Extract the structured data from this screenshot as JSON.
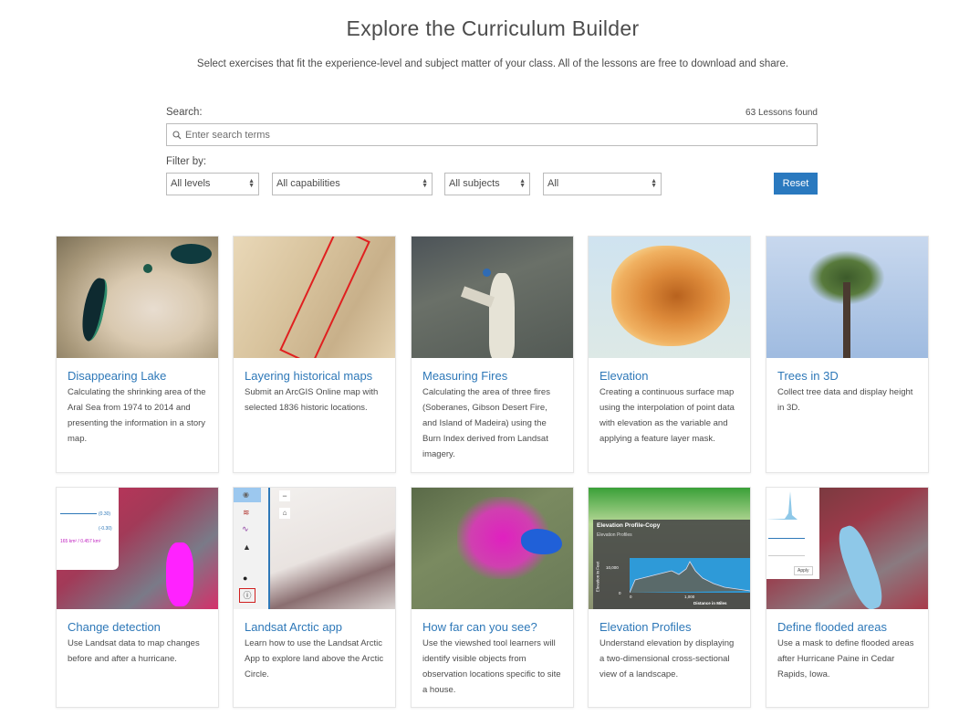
{
  "header": {
    "title": "Explore the Curriculum Builder",
    "subtitle": "Select exercises that fit the experience-level and subject matter of your class. All of the lessons are free to download and share."
  },
  "search": {
    "label": "Search:",
    "placeholder": "Enter search terms",
    "value": "",
    "results_count": "63 Lessons found",
    "icon": "search-icon"
  },
  "filters": {
    "label": "Filter by:",
    "levels": "All levels",
    "capabilities": "All capabilities",
    "subjects": "All subjects",
    "other": "All",
    "reset_label": "Reset"
  },
  "colors": {
    "accent": "#2a79bf",
    "card_title": "#2e78b8",
    "text": "#4c4c4c"
  },
  "lessons": [
    {
      "title": "Disappearing Lake",
      "description": "Calculating the shrinking area of the Aral Sea from 1974 to 2014 and presenting the information in a story map.",
      "thumbnail": "aral-sea-satellite-image"
    },
    {
      "title": "Layering historical maps",
      "description": "Submit an ArcGIS Online map with selected 1836 historic locations.",
      "thumbnail": "historic-map-image"
    },
    {
      "title": "Measuring Fires",
      "description": "Calculating the area of three fires (Soberanes, Gibson Desert Fire, and Island of Madeira) using the Burn Index derived from Landsat imagery.",
      "thumbnail": "burn-scar-image"
    },
    {
      "title": "Elevation",
      "description": "Creating a continuous surface map using the interpolation of point data with elevation as the variable and applying a feature layer mask.",
      "thumbnail": "elevation-surface-map"
    },
    {
      "title": "Trees in 3D",
      "description": "Collect tree data and display height in 3D.",
      "thumbnail": "palm-tree-photo"
    },
    {
      "title": "Change detection",
      "description": "Use Landsat data to map changes before and after a hurricane.",
      "thumbnail": "change-detection-image"
    },
    {
      "title": "Landsat Arctic app",
      "description": "Learn how to use the Landsat Arctic App to explore land above the Arctic Circle.",
      "thumbnail": "arctic-app-screenshot"
    },
    {
      "title": "How far can you see?",
      "description": "Use the viewshed tool learners will identify visible objects from observation locations specific to site a house.",
      "thumbnail": "viewshed-map"
    },
    {
      "title": "Elevation Profiles",
      "description": "Understand elevation by displaying a two-dimensional cross-sectional view of a landscape.",
      "thumbnail": "elevation-profile-chart"
    },
    {
      "title": "Define flooded areas",
      "description": "Use a mask to define flooded areas after Hurricane Paine in Cedar Rapids, Iowa.",
      "thumbnail": "flood-mask-image"
    }
  ],
  "thumbnail_text": {
    "elev_profile_title": "Elevation Profile-Copy",
    "elev_profile_subtitle": "Elevation Profiles",
    "elev_y_label": "Elevation in Feet",
    "elev_y_tick_top": "10,000",
    "elev_y_tick_zero": "0",
    "elev_x_tick_zero": "0",
    "elev_x_tick_mid": "1,000",
    "elev_x_label": "Distance in Miles",
    "flood_apply": "Apply",
    "change_value_1": "(0.30)",
    "change_value_2": "(-0.30)",
    "change_area": "165 km² / 0.457 km²"
  }
}
